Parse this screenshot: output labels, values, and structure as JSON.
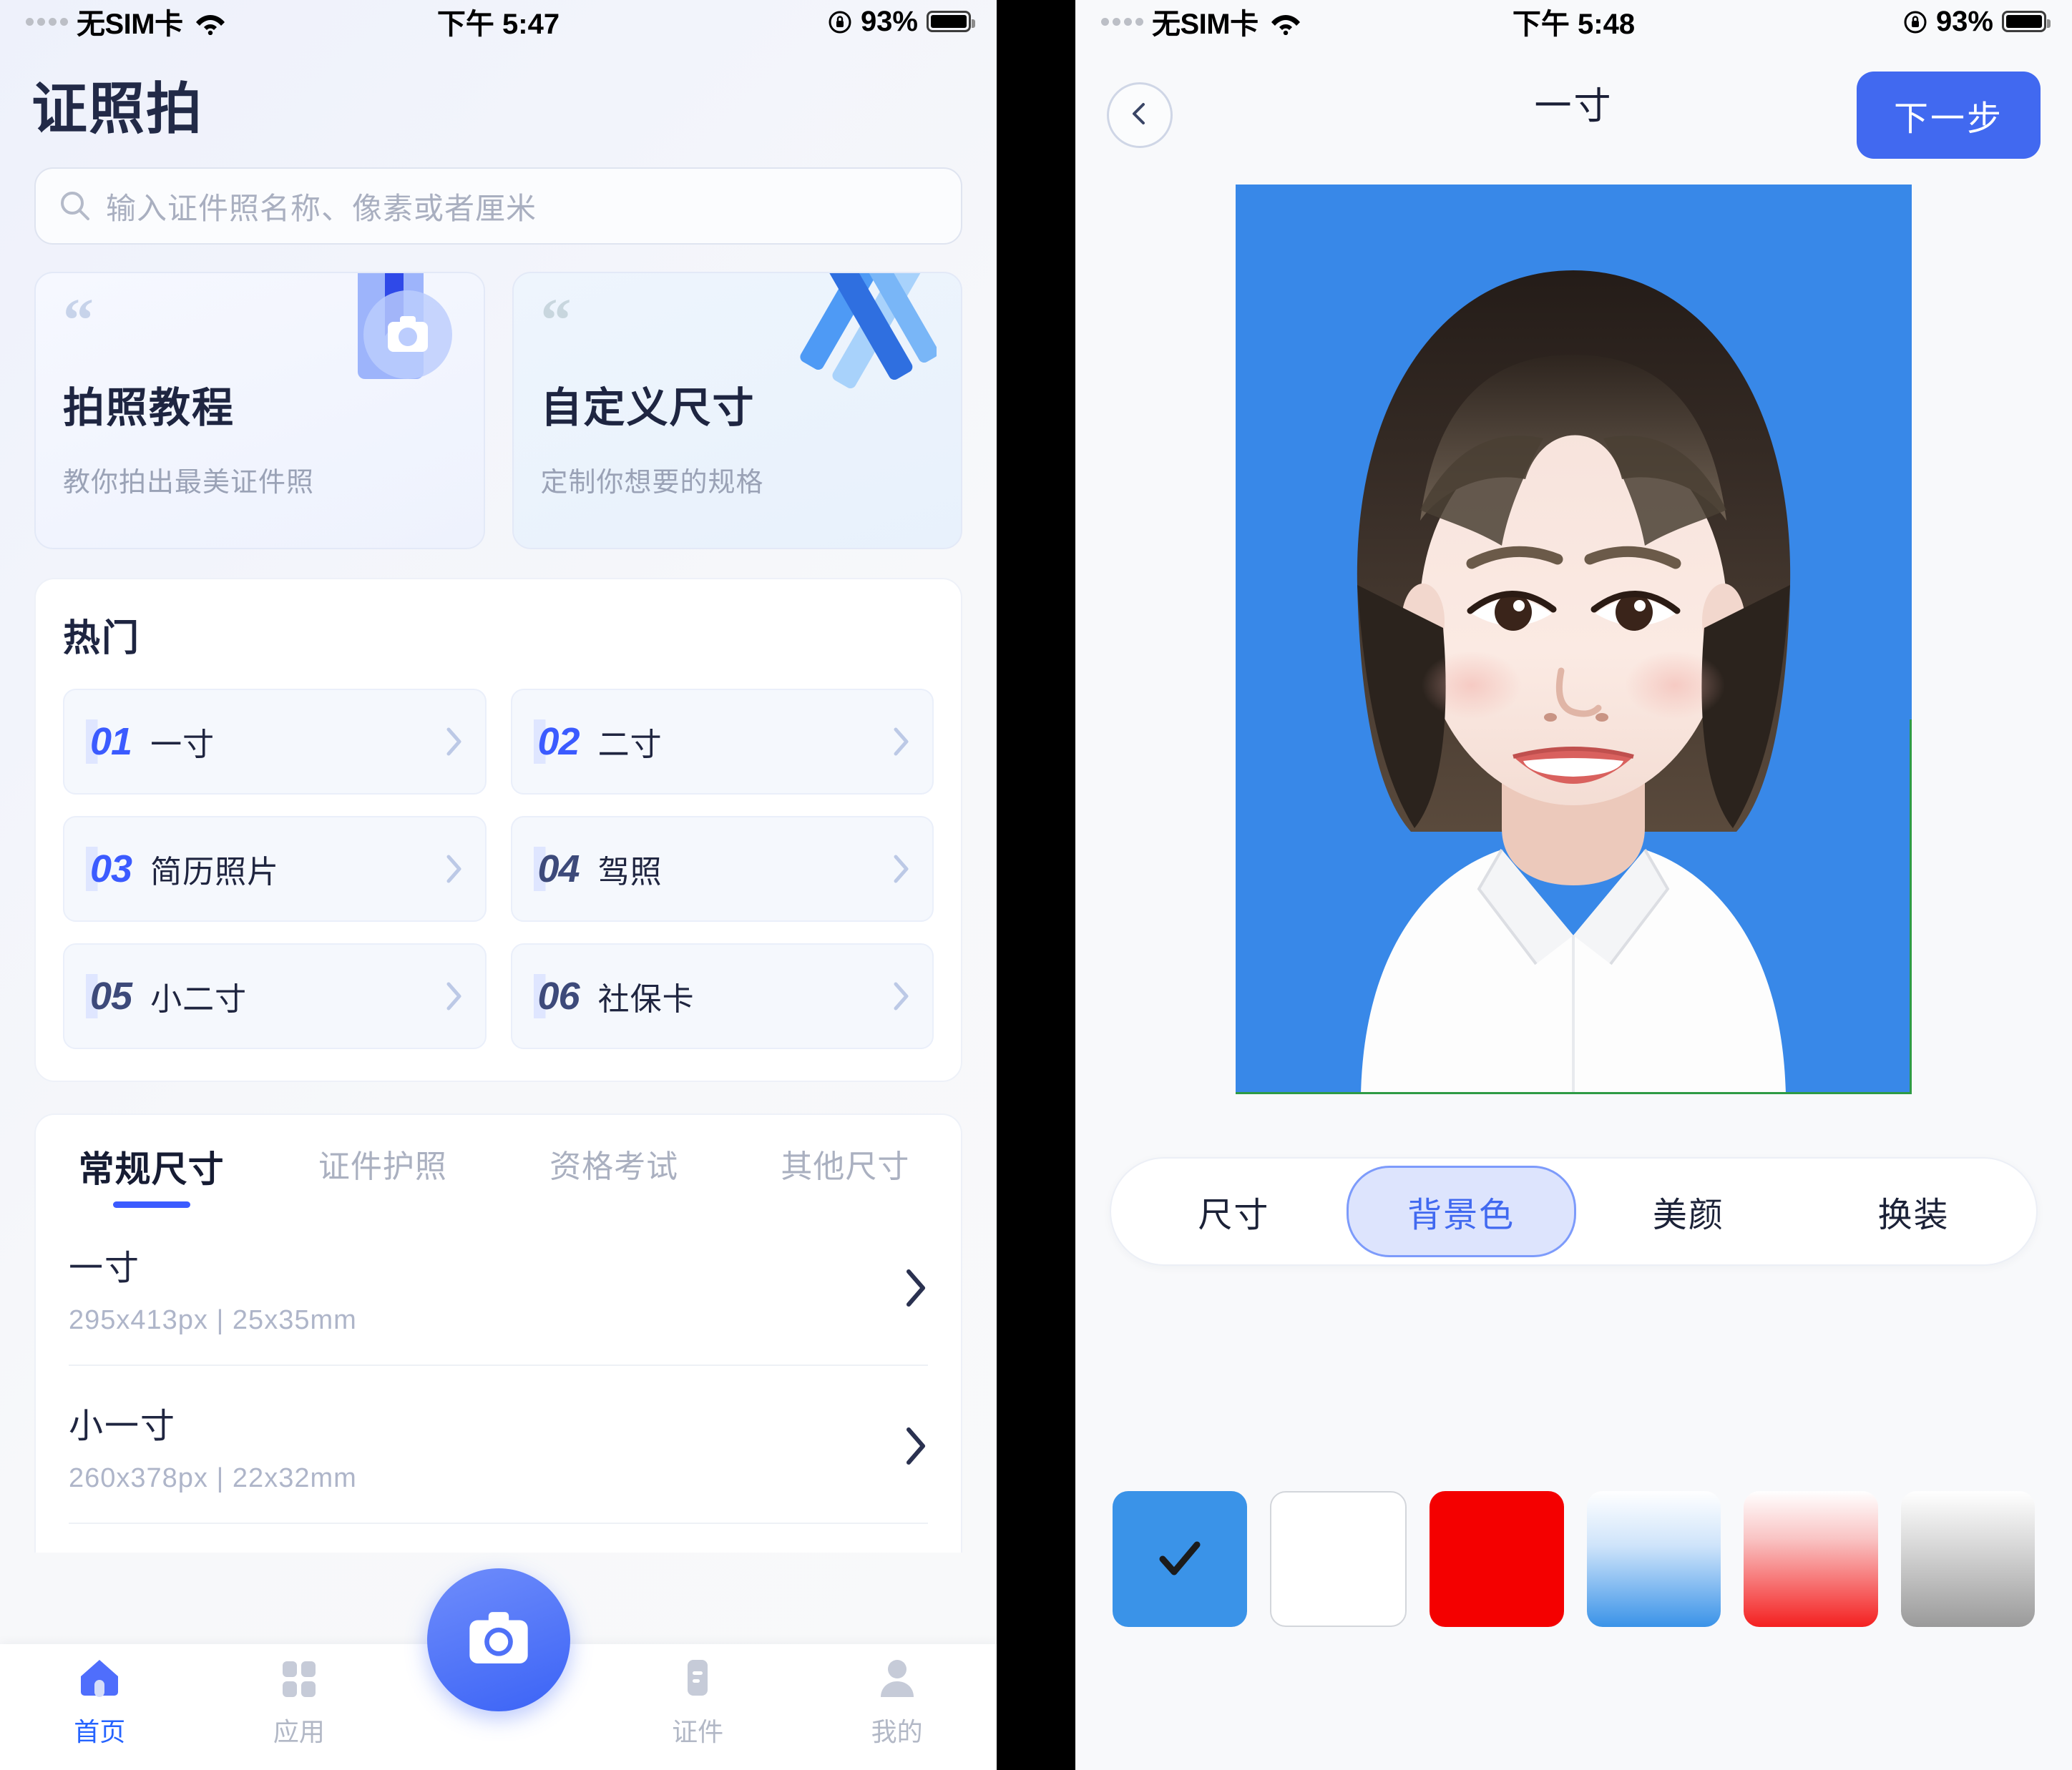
{
  "left": {
    "status": {
      "carrier": "无SIM卡",
      "time": "下午 5:47",
      "battery": "93%"
    },
    "app_title": "证照拍",
    "search": {
      "placeholder": "输入证件照名称、像素或者厘米",
      "icon": "search-icon"
    },
    "feature_cards": [
      {
        "title": "拍照教程",
        "subtitle": "教你拍出最美证件照",
        "icon": "book-camera-icon"
      },
      {
        "title": "自定义尺寸",
        "subtitle": "定制你想要的规格",
        "icon": "ruler-pencil-icon"
      }
    ],
    "hot": {
      "heading": "热门",
      "items": [
        {
          "num": "01",
          "label": "一寸"
        },
        {
          "num": "02",
          "label": "二寸"
        },
        {
          "num": "03",
          "label": "简历照片"
        },
        {
          "num": "04",
          "label": "驾照"
        },
        {
          "num": "05",
          "label": "小二寸"
        },
        {
          "num": "06",
          "label": "社保卡"
        }
      ]
    },
    "tabs": [
      {
        "label": "常规尺寸",
        "active": true
      },
      {
        "label": "证件护照",
        "active": false
      },
      {
        "label": "资格考试",
        "active": false
      },
      {
        "label": "其他尺寸",
        "active": false
      }
    ],
    "sizes": [
      {
        "name": "一寸",
        "spec": "295x413px  |  25x35mm"
      },
      {
        "name": "小一寸",
        "spec": "260x378px  |  22x32mm"
      }
    ],
    "tabbar": [
      {
        "label": "首页",
        "icon": "home-icon",
        "active": true
      },
      {
        "label": "应用",
        "icon": "grid-icon",
        "active": false
      },
      {
        "label": "证件",
        "icon": "id-card-icon",
        "active": false
      },
      {
        "label": "我的",
        "icon": "person-icon",
        "active": false
      }
    ],
    "camera_fab": {
      "icon": "camera-icon"
    }
  },
  "right": {
    "status": {
      "carrier": "无SIM卡",
      "time": "下午 5:48",
      "battery": "93%"
    },
    "nav": {
      "back_icon": "chevron-left-icon",
      "title": "一寸",
      "next_label": "下一步"
    },
    "photo": {
      "background_color": "#3888e8",
      "guide_color": "#2e9b45"
    },
    "segments": [
      {
        "label": "尺寸",
        "active": false
      },
      {
        "label": "背景色",
        "active": true
      },
      {
        "label": "美颜",
        "active": false
      },
      {
        "label": "换装",
        "active": false
      }
    ],
    "swatches": [
      {
        "name": "blue",
        "color": "#3a93e8",
        "type": "solid",
        "selected": true
      },
      {
        "name": "white",
        "color": "#ffffff",
        "type": "solid",
        "selected": false
      },
      {
        "name": "red",
        "color": "#f40000",
        "type": "solid",
        "selected": false
      },
      {
        "name": "blue-gradient",
        "color_from": "#ffffff",
        "color_to": "#3a93e8",
        "type": "gradient",
        "selected": false
      },
      {
        "name": "red-gradient",
        "color_from": "#ffffff",
        "color_to": "#f42020",
        "type": "gradient",
        "selected": false
      },
      {
        "name": "gray-gradient",
        "color_from": "#ffffff",
        "color_to": "#9a9a9a",
        "type": "gradient",
        "selected": false
      }
    ]
  },
  "theme": {
    "accent": "#3b5bff",
    "accent_button": "#4169f0",
    "text_dark": "#1e2541",
    "text_muted": "#aab0c0"
  }
}
